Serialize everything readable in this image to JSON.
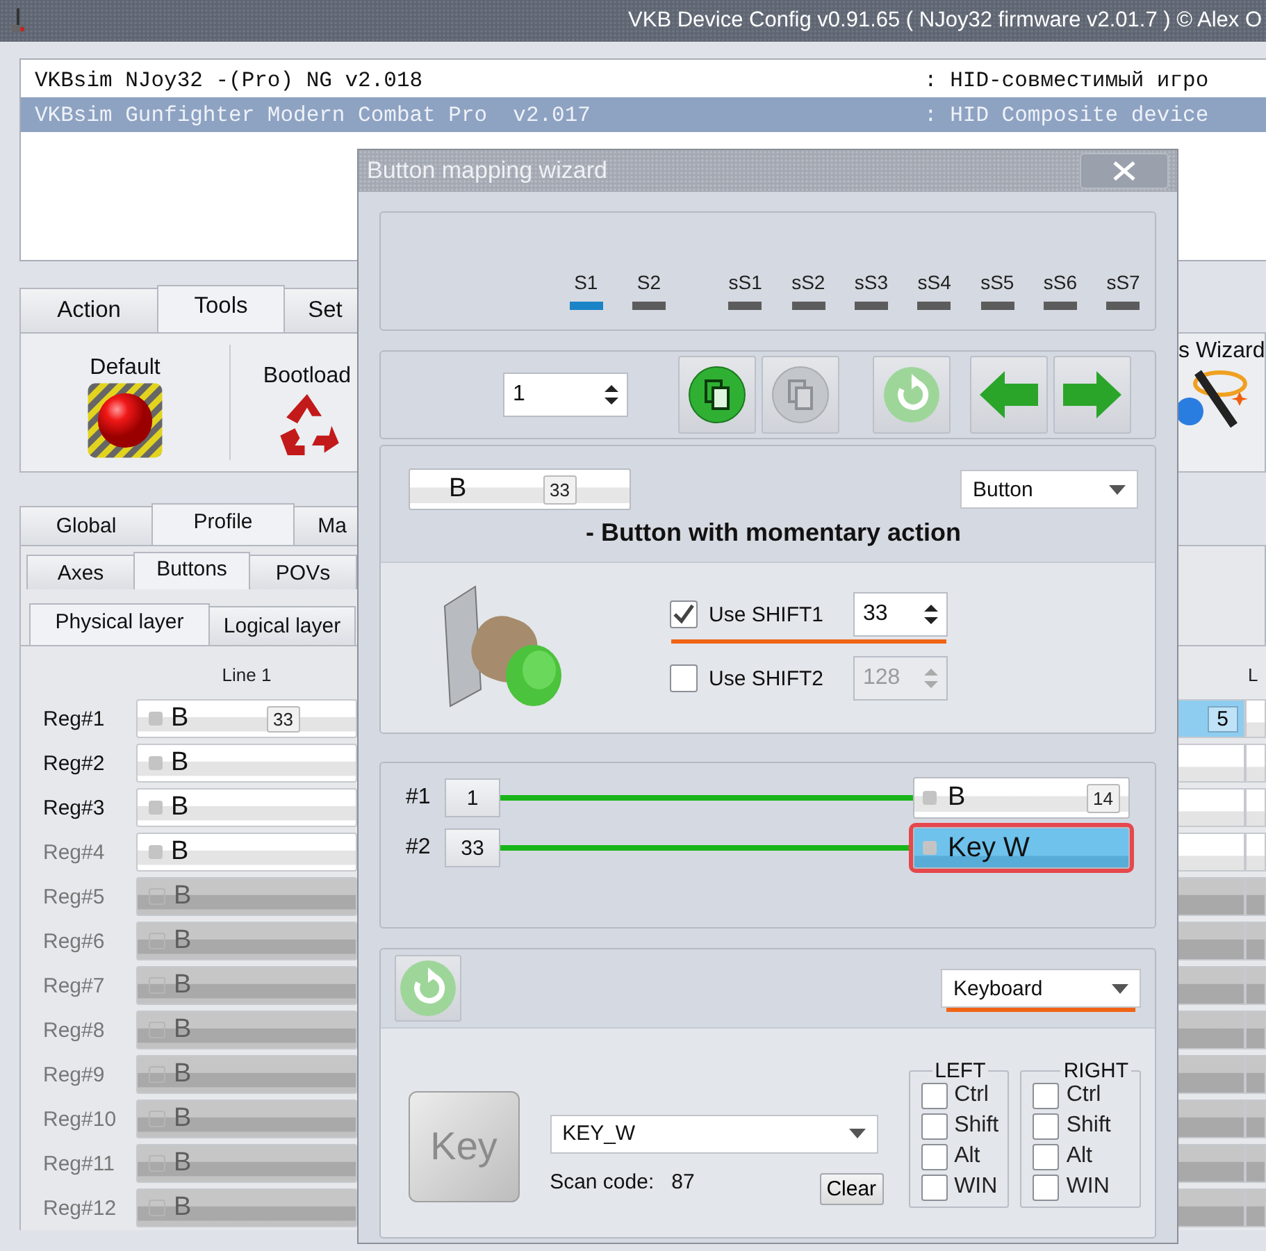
{
  "window": {
    "title": "VKB Device Config v0.91.65 ( NJoy32 firmware v2.01.7 ) © Alex O"
  },
  "devices": [
    {
      "name": "VKBsim NJoy32 -(Pro) NG v2.018",
      "description": ": HID-совместимый игро",
      "selected": false
    },
    {
      "name": "VKBsim Gunfighter Modern Combat Pro  v2.017",
      "description": ": HID Composite device",
      "selected": true
    }
  ],
  "main_tabs": [
    {
      "label": "Action",
      "selected": false
    },
    {
      "label": "Tools",
      "selected": true
    },
    {
      "label": "Set",
      "selected": false
    }
  ],
  "tools": [
    {
      "label": "Default",
      "kind": "default"
    },
    {
      "label": "Bootload",
      "kind": "bootloader"
    },
    {
      "label": "s Wizard",
      "kind": "wizard"
    }
  ],
  "profile_tabs": [
    {
      "label": "Global",
      "selected": false
    },
    {
      "label": "Profile",
      "selected": true
    },
    {
      "label": "Ma",
      "selected": false
    }
  ],
  "sub_tabs": [
    {
      "label": "Axes",
      "selected": false
    },
    {
      "label": "Buttons",
      "selected": true
    },
    {
      "label": "POVs",
      "selected": false
    }
  ],
  "layer_tabs": [
    {
      "label": "Physical layer",
      "selected": true
    },
    {
      "label": "Logical layer",
      "selected": false
    }
  ],
  "grid": {
    "column_1": "Line 1",
    "column_3": "L",
    "rows": [
      {
        "label": "Reg#1",
        "label_dim": false,
        "enabled": true,
        "name": "B",
        "count": "33",
        "right_count": "5",
        "right_selected": true
      },
      {
        "label": "Reg#2",
        "label_dim": false,
        "enabled": true,
        "name": "B",
        "right_selected": false
      },
      {
        "label": "Reg#3",
        "label_dim": false,
        "enabled": true,
        "name": "B",
        "right_selected": false
      },
      {
        "label": "Reg#4",
        "label_dim": true,
        "enabled": true,
        "name": "B",
        "right_selected": false
      },
      {
        "label": "Reg#5",
        "label_dim": true,
        "enabled": false,
        "name": "B",
        "right_selected": false
      },
      {
        "label": "Reg#6",
        "label_dim": true,
        "enabled": false,
        "name": "B",
        "right_selected": false
      },
      {
        "label": "Reg#7",
        "label_dim": true,
        "enabled": false,
        "name": "B",
        "right_selected": false
      },
      {
        "label": "Reg#8",
        "label_dim": true,
        "enabled": false,
        "name": "B",
        "right_selected": false
      },
      {
        "label": "Reg#9",
        "label_dim": true,
        "enabled": false,
        "name": "B",
        "right_selected": false
      },
      {
        "label": "Reg#10",
        "label_dim": true,
        "enabled": false,
        "name": "B",
        "right_selected": false
      },
      {
        "label": "Reg#11",
        "label_dim": true,
        "enabled": false,
        "name": "B",
        "right_selected": false
      },
      {
        "label": "Reg#12",
        "label_dim": true,
        "enabled": false,
        "name": "B",
        "right_selected": false
      }
    ]
  },
  "dialog": {
    "title": "Button mapping wizard",
    "shifts": [
      {
        "label": "S1",
        "kind": "shift",
        "active": true
      },
      {
        "label": "S2",
        "kind": "shift",
        "active": false
      },
      {
        "label": "sS1",
        "kind": "sub",
        "active": false
      },
      {
        "label": "sS2",
        "kind": "sub",
        "active": false
      },
      {
        "label": "sS3",
        "kind": "sub",
        "active": false
      },
      {
        "label": "sS4",
        "kind": "sub",
        "active": false
      },
      {
        "label": "sS5",
        "kind": "sub",
        "active": false
      },
      {
        "label": "sS6",
        "kind": "sub",
        "active": false
      },
      {
        "label": "sS7",
        "kind": "sub",
        "active": false
      }
    ],
    "spinner": "1",
    "toolbar": [
      {
        "kind": "copy",
        "disabled": false
      },
      {
        "kind": "paste",
        "disabled": true
      },
      {
        "kind": "reset",
        "disabled": true
      },
      {
        "kind": "prev",
        "disabled": false
      },
      {
        "kind": "next",
        "disabled": false
      }
    ],
    "button_chip": {
      "name": "B",
      "count": "33"
    },
    "type_select": "Button",
    "caption": "- Button with momentary action",
    "shift_options": [
      {
        "label": "Use SHIFT1",
        "checked": true,
        "value": "33",
        "disabled": false,
        "highlighted": true
      },
      {
        "label": "Use SHIFT2",
        "checked": false,
        "value": "128",
        "disabled": true,
        "highlighted": false
      }
    ],
    "mappings": [
      {
        "label": "#1",
        "index": "1",
        "target": "B",
        "count": "14",
        "selected": false
      },
      {
        "label": "#2",
        "index": "33",
        "target": "Key W",
        "selected": true
      }
    ],
    "output": {
      "value": "Keyboard",
      "highlighted": true
    },
    "key_image": "Key",
    "key_code": "KEY_W",
    "scan_label": "Scan code:",
    "scan_value": "87",
    "clear": "Clear",
    "modifier_groups": [
      {
        "title": "LEFT",
        "keys": [
          {
            "label": "Ctrl",
            "checked": false
          },
          {
            "label": "Shift",
            "checked": false
          },
          {
            "label": "Alt",
            "checked": false
          },
          {
            "label": "WIN",
            "checked": false
          }
        ]
      },
      {
        "title": "RIGHT",
        "keys": [
          {
            "label": "Ctrl",
            "checked": false
          },
          {
            "label": "Shift",
            "checked": false
          },
          {
            "label": "Alt",
            "checked": false
          },
          {
            "label": "WIN",
            "checked": false
          }
        ]
      }
    ]
  }
}
